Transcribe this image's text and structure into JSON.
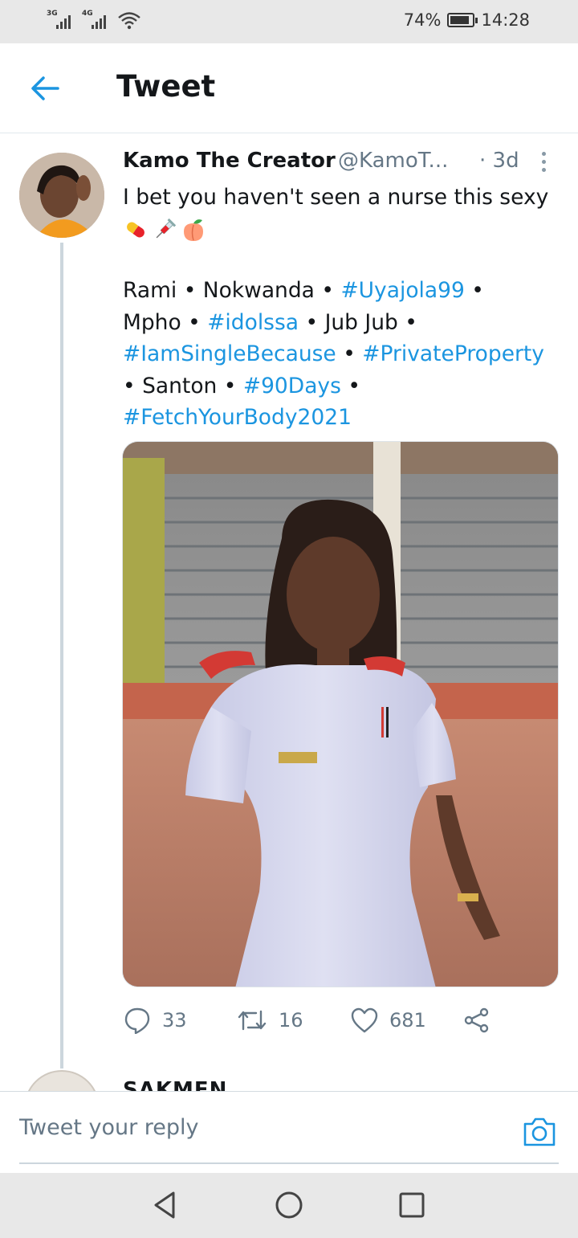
{
  "status_bar": {
    "signal1": "3G",
    "signal2": "4G",
    "battery_percent": "74%",
    "battery_level": 0.74,
    "time": "14:28"
  },
  "header": {
    "title": "Tweet",
    "back_icon": "arrow-left-icon"
  },
  "tweet": {
    "author_name": "Kamo The Creator",
    "author_handle": "@KamoT...",
    "time": "· 3d",
    "text": "I bet you haven't seen a nurse this sexy",
    "emojis": [
      "pill-emoji",
      "syringe-emoji",
      "peach-emoji"
    ],
    "tags": [
      {
        "text": "Rami",
        "link": false
      },
      {
        "text": "Nokwanda",
        "link": false
      },
      {
        "text": "#Uyajola99",
        "link": true
      },
      {
        "text": "Mpho",
        "link": false
      },
      {
        "text": "#idolssa",
        "link": true
      },
      {
        "text": "Jub Jub",
        "link": false
      },
      {
        "text": "#IamSingleBecause",
        "link": true
      },
      {
        "text": "#PrivateProperty",
        "link": true
      },
      {
        "text": "Santon",
        "link": false
      },
      {
        "text": "#90Days",
        "link": true
      },
      {
        "text": "#FetchYourBody2021",
        "link": true
      }
    ],
    "separator": "•",
    "actions": {
      "replies": "33",
      "retweets": "16",
      "likes": "681"
    }
  },
  "next_reply": {
    "author_name": "SAKMEN"
  },
  "reply_bar": {
    "placeholder": "Tweet your reply"
  },
  "colors": {
    "accent": "#1b95e0",
    "text": "#14171a",
    "muted": "#657786",
    "thread": "#ccd6dd"
  }
}
